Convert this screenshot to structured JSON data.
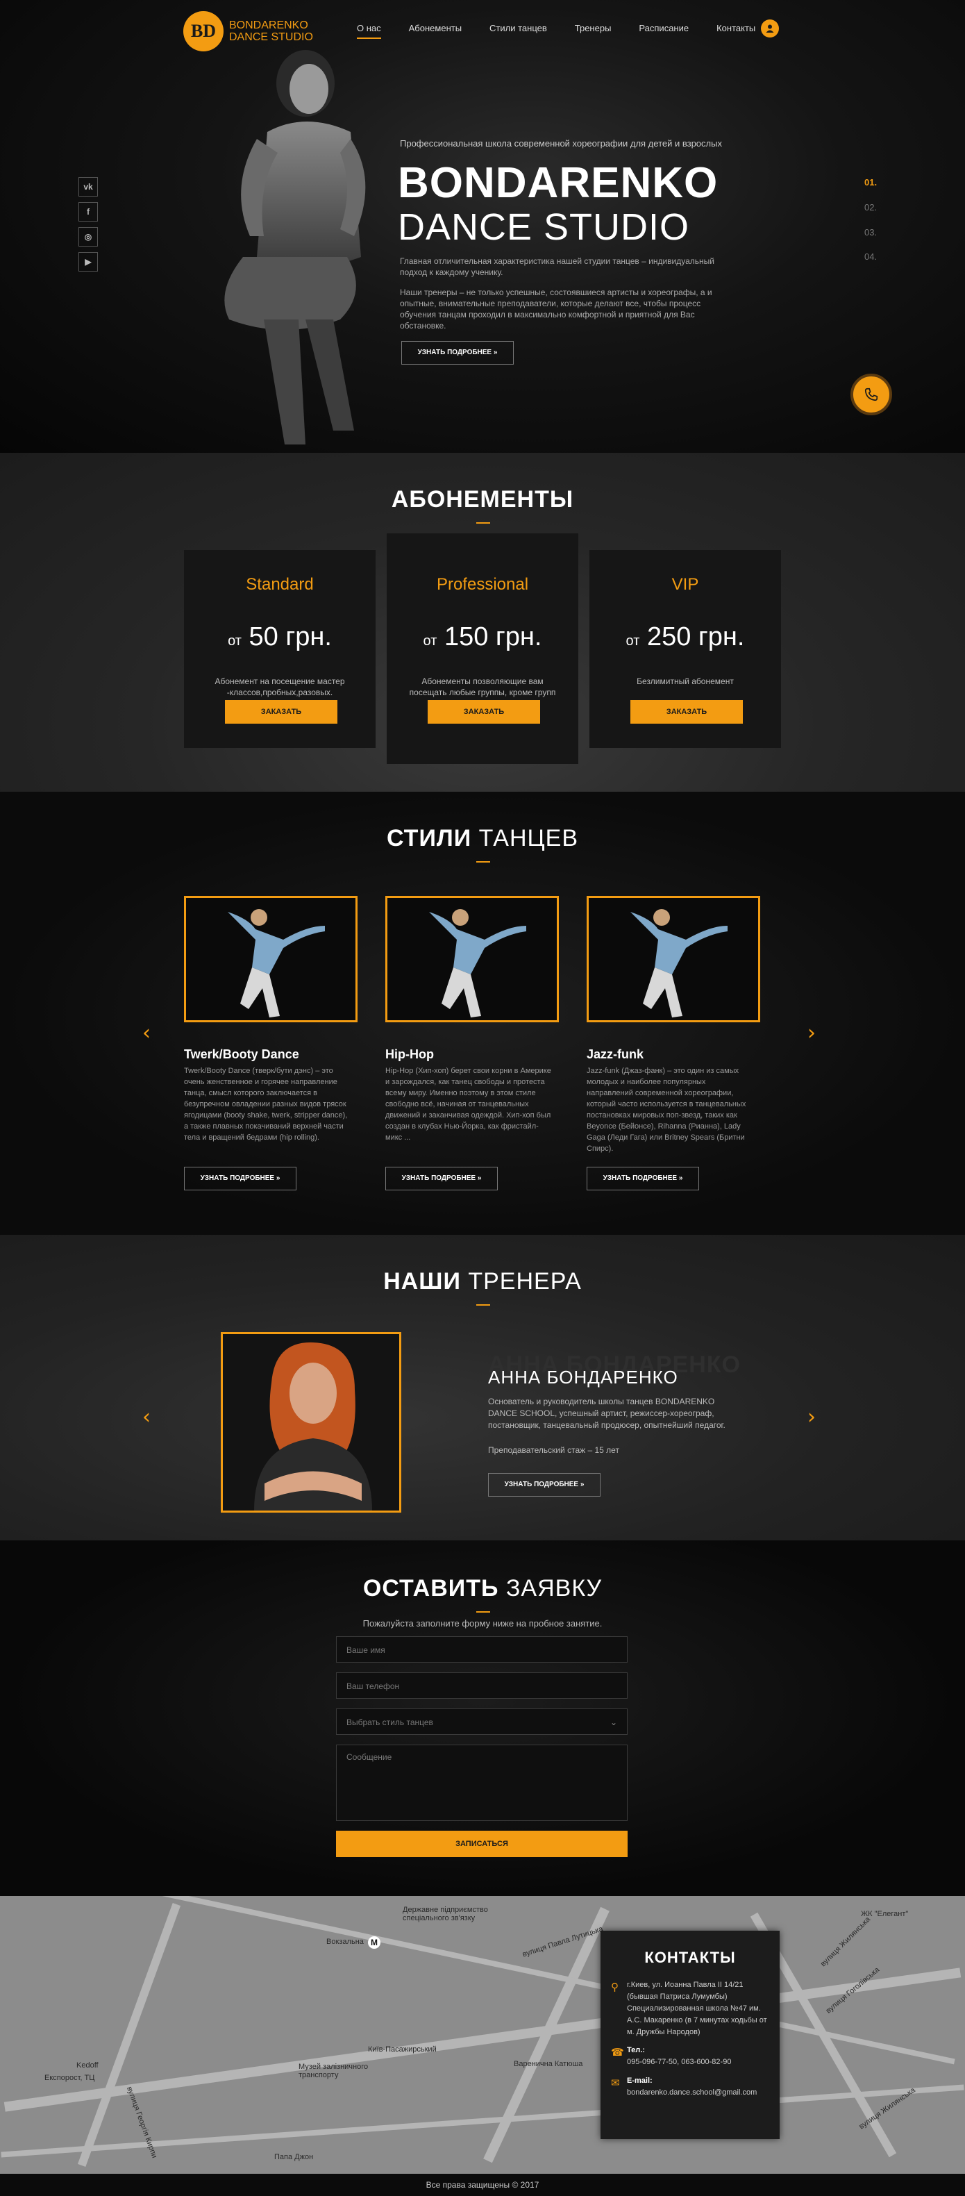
{
  "header": {
    "logo_mark": "BD",
    "logo_line1": "BONDARENKO",
    "logo_line2": "DANCE STUDIO",
    "nav": [
      "О нас",
      "Абонементы",
      "Стили танцев",
      "Тренеры",
      "Расписание",
      "Контакты"
    ],
    "active_nav": "О нас"
  },
  "social": [
    {
      "icon": "vk-icon",
      "glyph": "vk"
    },
    {
      "icon": "facebook-icon",
      "glyph": "f"
    },
    {
      "icon": "instagram-icon",
      "glyph": "◎"
    },
    {
      "icon": "youtube-icon",
      "glyph": "▶"
    }
  ],
  "hero": {
    "subtitle": "Профессиональная школа современной хореографии для детей и взрослых",
    "title1": "BONDARENKO",
    "title2": "DANCE STUDIO",
    "para1": "Главная отличительная характеристика нашей студии танцев – индивидуальный подход к каждому ученику.",
    "para2": "Наши тренеры – не только успешные, состоявшиеся артисты и хореографы, а и опытные, внимательные преподаватели, которые делают все, чтобы процесс обучения танцам проходил в максимально комфортной и приятной для Вас обстановке.",
    "button": "УЗНАТЬ ПОДРОБНЕЕ »",
    "slides": [
      "01.",
      "02.",
      "03.",
      "04."
    ],
    "current_slide": "01."
  },
  "pricing": {
    "title_bold": "АБОНЕМЕНТЫ",
    "title_light": "",
    "plans": [
      {
        "name": "Standard",
        "prefix": "от",
        "price": "50 грн.",
        "desc": "Абонемент на посещение мастер -классов,пробных,разовых.",
        "button": "ЗАКАЗАТЬ"
      },
      {
        "name": "Professional",
        "prefix": "от",
        "price": "150 грн.",
        "desc": "Абонементы позволяющие вам посещать любые группы, кроме групп TOP",
        "button": "ЗАКАЗАТЬ"
      },
      {
        "name": "VIP",
        "prefix": "от",
        "price": "250 грн.",
        "desc": "Безлимитный абонемент",
        "button": "ЗАКАЗАТЬ"
      }
    ]
  },
  "styles": {
    "title_bold": "СТИЛИ",
    "title_light": "ТАНЦЕВ",
    "items": [
      {
        "name": "Twerk/Booty Dance",
        "desc": "Twerk/Booty Dance (тверк/бути дэнс) – это очень женственное и горячее направление танца, смысл которого заключается в безупречном овладении разных видов трясок ягодицами (booty shake, twerk, stripper dance), а также плавных покачиваний верхней части тела и вращений бедрами (hip rolling).",
        "button": "УЗНАТЬ ПОДРОБНЕЕ »"
      },
      {
        "name": "Hip-Hop",
        "desc": "Hip-Hop (Хип-хоп) берет свои корни в Америке и зарождался, как танец свободы и протеста всему миру. Именно поэтому в этом стиле свободно всё, начиная от танцевальных движений и заканчивая одеждой. Хип-хоп был создан в клубах Нью-Йорка, как фристайл-микс ...",
        "button": "УЗНАТЬ ПОДРОБНЕЕ »"
      },
      {
        "name": "Jazz-funk",
        "desc": "Jazz-funk (Джаз-фанк) – это один из самых молодых и наиболее популярных направлений современной хореографии, который часто используется в танцевальных постановках мировых поп-звезд, таких как Beyonce (Бейонсе), Rihanna (Рианна), Lady Gaga (Леди Гага) или Britney Spears (Бритни Спирс).",
        "button": "УЗНАТЬ ПОДРОБНЕЕ »"
      }
    ]
  },
  "trainers": {
    "title_bold": "НАШИ",
    "title_light": "ТРЕНЕРА",
    "ghost_name": "АННА БОНДАРЕНКО",
    "name": "АННА БОНДАРЕНКО",
    "desc": "Основатель и руководитель школы танцев BONDARENKO DANCE SCHOOL, успешный артист, режиссер-хореограф, постановщик, танцевальный продюсер, опытнейший педагог.",
    "experience": "Преподавательский стаж – 15 лет",
    "button": "УЗНАТЬ ПОДРОБНЕЕ »"
  },
  "form": {
    "title_bold": "ОСТАВИТЬ",
    "title_light": "ЗАЯВКУ",
    "subtitle": "Пожалуйста заполните форму ниже на пробное занятие.",
    "name_placeholder": "Ваше имя",
    "phone_placeholder": "Ваш телефон",
    "style_select": "Выбрать стиль танцев",
    "message_placeholder": "Сообщение",
    "submit": "ЗАПИСАТЬСЯ"
  },
  "map": {
    "labels": [
      "Державне підприємство спеціального зв'язку",
      "Вокзальна",
      "вулиця Павла Лутицька",
      "вулиця Гоголівська",
      "вулиця Жилянська",
      "ЖК \"Елегант\"",
      "Музей залізничного транспорту",
      "Київ-Пасажирський",
      "Варенична Катюша",
      "Експорост, ТЦ",
      "Kedoff",
      "вулиця Георгія Кирпи",
      "Папа Джон",
      "вулиця Жилянська"
    ]
  },
  "contacts": {
    "title": "КОНТАКТЫ",
    "address": "г.Киев, ул. Иоанна Павла II 14/21 (бывшая Патриса Лумумбы) Специализированная школа №47 им. А.С. Макаренко (в 7 минутах ходьбы от м. Дружбы Народов)",
    "tel_label": "Тел.:",
    "tel": "095-096-77-50, 063-600-82-90",
    "email_label": "E-mail:",
    "email": "bondarenko.dance.school@gmail.com"
  },
  "footer": {
    "text": "Все права защищены © 2017"
  },
  "colors": {
    "accent": "#f39c12",
    "dark": "#161616"
  }
}
